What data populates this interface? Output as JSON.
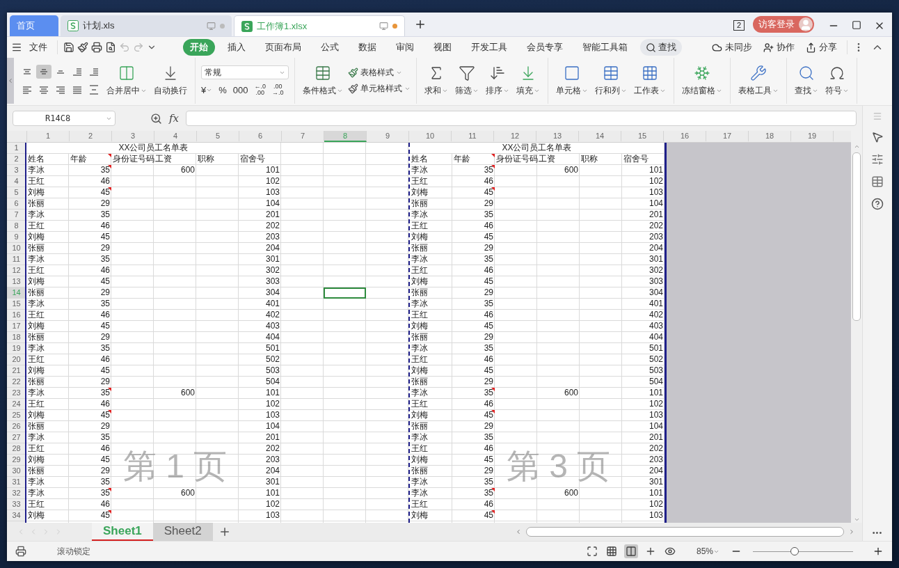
{
  "title_tabs": [
    {
      "kind": "home",
      "label": "首页",
      "selected": false
    },
    {
      "kind": "file",
      "label": "计划.xls",
      "selected": false,
      "unsaved": false
    },
    {
      "kind": "file",
      "label": "工作簿1.xlsx",
      "selected": true,
      "unsaved": true
    }
  ],
  "window_count": "2",
  "login_button": "访客登录",
  "file_menu": "文件",
  "menu_tabs": [
    {
      "label": "开始",
      "selected": true
    },
    {
      "label": "插入",
      "selected": false
    },
    {
      "label": "页面布局",
      "selected": false
    },
    {
      "label": "公式",
      "selected": false
    },
    {
      "label": "数据",
      "selected": false
    },
    {
      "label": "审阅",
      "selected": false
    },
    {
      "label": "视图",
      "selected": false
    },
    {
      "label": "开发工具",
      "selected": false
    },
    {
      "label": "会员专享",
      "selected": false
    },
    {
      "label": "智能工具箱",
      "selected": false
    }
  ],
  "search_label": "查找",
  "menu_actions": [
    {
      "kind": "sync",
      "label": "未同步"
    },
    {
      "kind": "collab",
      "label": "协作"
    },
    {
      "kind": "share",
      "label": "分享"
    }
  ],
  "align_buttons": [
    {
      "kind": "top",
      "selected": false
    },
    {
      "kind": "middle",
      "selected": true
    },
    {
      "kind": "bottom",
      "selected": false
    },
    {
      "kind": "outdent",
      "selected": false
    },
    {
      "kind": "indent",
      "selected": false
    },
    {
      "kind": "left",
      "selected": false
    },
    {
      "kind": "center",
      "selected": false
    },
    {
      "kind": "right",
      "selected": false
    },
    {
      "kind": "justify",
      "selected": false
    },
    {
      "kind": "distribute",
      "selected": false
    }
  ],
  "merge_buttons": [
    {
      "kind": "merge",
      "label": "合并居中",
      "dropdown": true
    },
    {
      "kind": "wrap",
      "label": "自动换行",
      "dropdown": false
    }
  ],
  "number_format": "常规",
  "number_buttons": [
    {
      "lines": [
        "¥"
      ],
      "dropdown": true
    },
    {
      "lines": [
        "%"
      ],
      "dropdown": false
    },
    {
      "lines": [
        "000"
      ],
      "dropdown": false
    },
    {
      "lines": [
        "←.0",
        ".00"
      ],
      "dropdown": false
    },
    {
      "lines": [
        ".00",
        "→.0"
      ],
      "dropdown": false
    }
  ],
  "style_buttons": [
    {
      "kind": "conditional",
      "label": "条件格式",
      "dropdown": true
    }
  ],
  "style_small": [
    {
      "kind": "table_style",
      "label": "表格样式",
      "dropdown": true
    },
    {
      "kind": "cell_style",
      "label": "单元格样式",
      "dropdown": true
    }
  ],
  "tool_groups": [
    [
      {
        "kind": "sum",
        "label": "求和",
        "dropdown": true
      },
      {
        "kind": "filter",
        "label": "筛选",
        "dropdown": true
      },
      {
        "kind": "sort",
        "label": "排序",
        "dropdown": true
      },
      {
        "kind": "fill",
        "label": "填充",
        "dropdown": true
      }
    ],
    [
      {
        "kind": "cell",
        "label": "单元格",
        "dropdown": true
      },
      {
        "kind": "rowcol",
        "label": "行和列",
        "dropdown": true
      },
      {
        "kind": "sheet",
        "label": "工作表",
        "dropdown": true
      }
    ],
    [
      {
        "kind": "freeze",
        "label": "冻结窗格",
        "dropdown": true
      }
    ],
    [
      {
        "kind": "tools",
        "label": "表格工具",
        "dropdown": true
      }
    ],
    [
      {
        "kind": "find",
        "label": "查找",
        "dropdown": true
      },
      {
        "kind": "symbol",
        "label": "符号",
        "dropdown": true
      }
    ]
  ],
  "name_box": "R14C8",
  "fx_label": "fx",
  "columns": [
    {
      "label": "1",
      "selected": false
    },
    {
      "label": "2",
      "selected": false
    },
    {
      "label": "3",
      "selected": false
    },
    {
      "label": "4",
      "selected": false
    },
    {
      "label": "5",
      "selected": false
    },
    {
      "label": "6",
      "selected": false
    },
    {
      "label": "7",
      "selected": false
    },
    {
      "label": "8",
      "selected": true
    },
    {
      "label": "9",
      "selected": false
    },
    {
      "label": "10",
      "selected": false
    },
    {
      "label": "11",
      "selected": false
    },
    {
      "label": "12",
      "selected": false
    },
    {
      "label": "13",
      "selected": false
    },
    {
      "label": "14",
      "selected": false
    },
    {
      "label": "15",
      "selected": false
    },
    {
      "label": "16",
      "selected": false
    },
    {
      "label": "17",
      "selected": false
    },
    {
      "label": "18",
      "selected": false
    },
    {
      "label": "19",
      "selected": false
    }
  ],
  "row_headers": [
    {
      "label": "1",
      "selected": false
    },
    {
      "label": "2",
      "selected": false
    },
    {
      "label": "3",
      "selected": false
    },
    {
      "label": "4",
      "selected": false
    },
    {
      "label": "5",
      "selected": false
    },
    {
      "label": "6",
      "selected": false
    },
    {
      "label": "7",
      "selected": false
    },
    {
      "label": "8",
      "selected": false
    },
    {
      "label": "9",
      "selected": false
    },
    {
      "label": "10",
      "selected": false
    },
    {
      "label": "11",
      "selected": false
    },
    {
      "label": "12",
      "selected": false
    },
    {
      "label": "13",
      "selected": false
    },
    {
      "label": "14",
      "selected": true
    },
    {
      "label": "15",
      "selected": false
    },
    {
      "label": "16",
      "selected": false
    },
    {
      "label": "17",
      "selected": false
    },
    {
      "label": "18",
      "selected": false
    },
    {
      "label": "19",
      "selected": false
    },
    {
      "label": "20",
      "selected": false
    },
    {
      "label": "21",
      "selected": false
    },
    {
      "label": "22",
      "selected": false
    },
    {
      "label": "23",
      "selected": false
    },
    {
      "label": "24",
      "selected": false
    },
    {
      "label": "25",
      "selected": false
    },
    {
      "label": "26",
      "selected": false
    },
    {
      "label": "27",
      "selected": false
    },
    {
      "label": "28",
      "selected": false
    },
    {
      "label": "29",
      "selected": false
    },
    {
      "label": "30",
      "selected": false
    },
    {
      "label": "31",
      "selected": false
    },
    {
      "label": "32",
      "selected": false
    },
    {
      "label": "33",
      "selected": false
    },
    {
      "label": "34",
      "selected": false
    }
  ],
  "pages": [
    {
      "label": "第 1 页",
      "title": "XX公司员工名单表",
      "headers": [
        {
          "label": "姓名",
          "comment": false
        },
        {
          "label": "年龄",
          "comment": true
        },
        {
          "label": "身份证号码",
          "comment": false
        },
        {
          "label": "工资",
          "comment": false
        },
        {
          "label": "职称",
          "comment": false
        },
        {
          "label": "宿舍号",
          "comment": false
        }
      ],
      "rows": [
        {
          "name": "李冰",
          "age": "35",
          "salary": "600",
          "dorm": "101",
          "comment": true
        },
        {
          "name": "王红",
          "age": "46",
          "dorm": "102",
          "comment": false
        },
        {
          "name": "刘梅",
          "age": "45",
          "dorm": "103",
          "comment": true
        },
        {
          "name": "张丽",
          "age": "29",
          "dorm": "104",
          "comment": false
        },
        {
          "name": "李冰",
          "age": "35",
          "dorm": "201",
          "comment": false
        },
        {
          "name": "王红",
          "age": "46",
          "dorm": "202",
          "comment": false
        },
        {
          "name": "刘梅",
          "age": "45",
          "dorm": "203",
          "comment": false
        },
        {
          "name": "张丽",
          "age": "29",
          "dorm": "204",
          "comment": false
        },
        {
          "name": "李冰",
          "age": "35",
          "dorm": "301",
          "comment": false
        },
        {
          "name": "王红",
          "age": "46",
          "dorm": "302",
          "comment": false
        },
        {
          "name": "刘梅",
          "age": "45",
          "dorm": "303",
          "comment": false
        },
        {
          "name": "张丽",
          "age": "29",
          "dorm": "304",
          "comment": false
        },
        {
          "name": "李冰",
          "age": "35",
          "dorm": "401",
          "comment": false
        },
        {
          "name": "王红",
          "age": "46",
          "dorm": "402",
          "comment": false
        },
        {
          "name": "刘梅",
          "age": "45",
          "dorm": "403",
          "comment": false
        },
        {
          "name": "张丽",
          "age": "29",
          "dorm": "404",
          "comment": false
        },
        {
          "name": "李冰",
          "age": "35",
          "dorm": "501",
          "comment": false
        },
        {
          "name": "王红",
          "age": "46",
          "dorm": "502",
          "comment": false
        },
        {
          "name": "刘梅",
          "age": "45",
          "dorm": "503",
          "comment": false
        },
        {
          "name": "张丽",
          "age": "29",
          "dorm": "504",
          "comment": false
        },
        {
          "name": "李冰",
          "age": "35",
          "salary": "600",
          "dorm": "101",
          "comment": true
        },
        {
          "name": "王红",
          "age": "46",
          "dorm": "102",
          "comment": false
        },
        {
          "name": "刘梅",
          "age": "45",
          "dorm": "103",
          "comment": true
        },
        {
          "name": "张丽",
          "age": "29",
          "dorm": "104",
          "comment": false
        },
        {
          "name": "李冰",
          "age": "35",
          "dorm": "201",
          "comment": false
        },
        {
          "name": "王红",
          "age": "46",
          "dorm": "202",
          "comment": false
        },
        {
          "name": "刘梅",
          "age": "45",
          "dorm": "203",
          "comment": false
        },
        {
          "name": "张丽",
          "age": "29",
          "dorm": "204",
          "comment": false
        },
        {
          "name": "李冰",
          "age": "35",
          "dorm": "301",
          "comment": false
        },
        {
          "name": "李冰",
          "age": "35",
          "salary": "600",
          "dorm": "101",
          "comment": true
        },
        {
          "name": "王红",
          "age": "46",
          "dorm": "102",
          "comment": false
        },
        {
          "name": "刘梅",
          "age": "45",
          "dorm": "103",
          "comment": true
        }
      ]
    },
    {
      "label": "第 3 页",
      "title": "XX公司员工名单表",
      "headers": [
        {
          "label": "姓名",
          "comment": false
        },
        {
          "label": "年龄",
          "comment": true
        },
        {
          "label": "身份证号码",
          "comment": false
        },
        {
          "label": "工资",
          "comment": false
        },
        {
          "label": "职称",
          "comment": false
        },
        {
          "label": "宿舍号",
          "comment": false
        }
      ],
      "rows": [
        {
          "name": "李冰",
          "age": "35",
          "salary": "600",
          "dorm": "101",
          "comment": true
        },
        {
          "name": "王红",
          "age": "46",
          "dorm": "102",
          "comment": false
        },
        {
          "name": "刘梅",
          "age": "45",
          "dorm": "103",
          "comment": true
        },
        {
          "name": "张丽",
          "age": "29",
          "dorm": "104",
          "comment": false
        },
        {
          "name": "李冰",
          "age": "35",
          "dorm": "201",
          "comment": false
        },
        {
          "name": "王红",
          "age": "46",
          "dorm": "202",
          "comment": false
        },
        {
          "name": "刘梅",
          "age": "45",
          "dorm": "203",
          "comment": false
        },
        {
          "name": "张丽",
          "age": "29",
          "dorm": "204",
          "comment": false
        },
        {
          "name": "李冰",
          "age": "35",
          "dorm": "301",
          "comment": false
        },
        {
          "name": "王红",
          "age": "46",
          "dorm": "302",
          "comment": false
        },
        {
          "name": "刘梅",
          "age": "45",
          "dorm": "303",
          "comment": false
        },
        {
          "name": "张丽",
          "age": "29",
          "dorm": "304",
          "comment": false
        },
        {
          "name": "李冰",
          "age": "35",
          "dorm": "401",
          "comment": false
        },
        {
          "name": "王红",
          "age": "46",
          "dorm": "402",
          "comment": false
        },
        {
          "name": "刘梅",
          "age": "45",
          "dorm": "403",
          "comment": false
        },
        {
          "name": "张丽",
          "age": "29",
          "dorm": "404",
          "comment": false
        },
        {
          "name": "李冰",
          "age": "35",
          "dorm": "501",
          "comment": false
        },
        {
          "name": "王红",
          "age": "46",
          "dorm": "502",
          "comment": false
        },
        {
          "name": "刘梅",
          "age": "45",
          "dorm": "503",
          "comment": false
        },
        {
          "name": "张丽",
          "age": "29",
          "dorm": "504",
          "comment": false
        },
        {
          "name": "李冰",
          "age": "35",
          "salary": "600",
          "dorm": "101",
          "comment": true
        },
        {
          "name": "王红",
          "age": "46",
          "dorm": "102",
          "comment": false
        },
        {
          "name": "刘梅",
          "age": "45",
          "dorm": "103",
          "comment": true
        },
        {
          "name": "张丽",
          "age": "29",
          "dorm": "104",
          "comment": false
        },
        {
          "name": "李冰",
          "age": "35",
          "dorm": "201",
          "comment": false
        },
        {
          "name": "王红",
          "age": "46",
          "dorm": "202",
          "comment": false
        },
        {
          "name": "刘梅",
          "age": "45",
          "dorm": "203",
          "comment": false
        },
        {
          "name": "张丽",
          "age": "29",
          "dorm": "204",
          "comment": false
        },
        {
          "name": "李冰",
          "age": "35",
          "dorm": "301",
          "comment": false
        },
        {
          "name": "李冰",
          "age": "35",
          "salary": "600",
          "dorm": "101",
          "comment": true
        },
        {
          "name": "王红",
          "age": "46",
          "dorm": "102",
          "comment": false
        },
        {
          "name": "刘梅",
          "age": "45",
          "dorm": "103",
          "comment": true
        }
      ]
    }
  ],
  "sheet_tabs": [
    {
      "label": "Sheet1",
      "selected": true
    },
    {
      "label": "Sheet2",
      "selected": false
    }
  ],
  "sidebar_more": "•••",
  "status_text": "滚动锁定",
  "view_buttons": [
    {
      "kind": "fullscreen",
      "selected": false
    },
    {
      "kind": "normal",
      "selected": false
    },
    {
      "kind": "pagebreak",
      "selected": true
    },
    {
      "kind": "split",
      "selected": false
    },
    {
      "kind": "eye",
      "selected": false
    }
  ],
  "zoom": {
    "label": "85%",
    "level": 0.42
  }
}
